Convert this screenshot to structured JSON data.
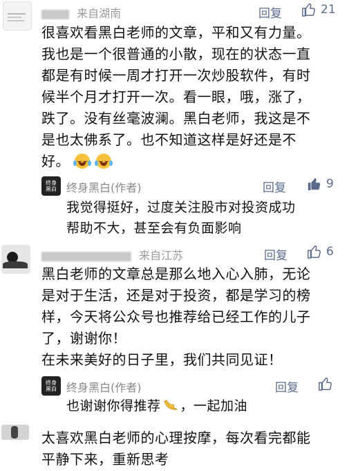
{
  "comments": [
    {
      "location": "来自湖南",
      "reply_label": "回复",
      "likes": "21",
      "text_lines": [
        "很喜欢看黑白老师的文章，平和又有力量。",
        "我也是一个很普通的小散，现在的状态一直",
        "都是有时候一周才打开一次炒股软件，有时",
        "候半个月才打开一次。看一眼，哦，涨了，",
        "跌了。没有丝毫波澜。黑白老师，我这是不",
        "是也太佛系了。也不知道这样是好还是不",
        "好。"
      ],
      "emoji_names": [
        "laughing-crying-emoji",
        "laughing-crying-emoji"
      ],
      "author_reply": {
        "name": "终身黑白(作者)",
        "avatar_text": "终身黑白",
        "reply_label": "回复",
        "likes": "9",
        "liked": true,
        "text_lines": [
          "我觉得挺好，过度关注股市对投资成功",
          "帮助不大，甚至会有负面影响"
        ]
      }
    },
    {
      "location": "来自江苏",
      "reply_label": "回复",
      "likes": "6",
      "text_lines": [
        "黑白老师的文章总是那么地入心入肺，无论",
        "是对于生活，还是对于投资，都是学习的榜",
        "样，今天将公众号也推荐给已经工作的儿子",
        "了，谢谢你！",
        "在未来美好的日子里，我们共同见证！"
      ],
      "author_reply": {
        "name": "终身黑白(作者)",
        "avatar_text": "终身黑白",
        "reply_label": "回复",
        "likes": "",
        "liked": false,
        "text_before_emoji": "也谢谢你得推荐",
        "text_after_emoji": "，一起加油",
        "emoji_name": "banana-emoji"
      }
    },
    {
      "text_lines": [
        "太喜欢黑白老师的心理按摩，每次看完都能",
        "平静下来，重新思考"
      ]
    }
  ],
  "colors": {
    "link": "#5a6c8c",
    "muted": "#888888",
    "liked": "#5a6c8c"
  }
}
